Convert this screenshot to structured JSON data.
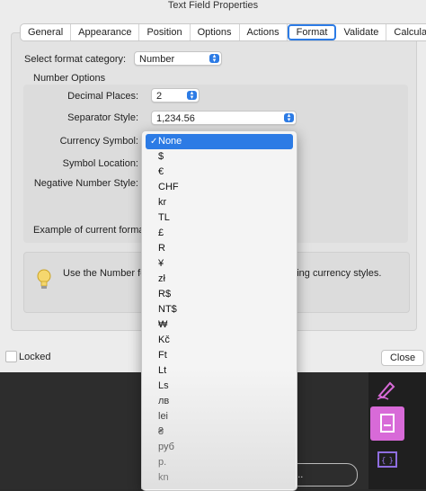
{
  "window": {
    "title": "Text Field Properties"
  },
  "tabs": [
    "General",
    "Appearance",
    "Position",
    "Options",
    "Actions",
    "Format",
    "Validate",
    "Calculate"
  ],
  "active_tab": "Format",
  "format": {
    "category_label": "Select format category:",
    "category_value": "Number",
    "section_title": "Number Options",
    "decimal_label": "Decimal Places:",
    "decimal_value": "2",
    "separator_label": "Separator Style:",
    "separator_value": "1,234.56",
    "currency_label": "Currency Symbol:",
    "symbol_location_label": "Symbol Location:",
    "negative_label": "Negative Number Style:",
    "example_label": "Example of current format:",
    "info_text_left": "Use the Number for",
    "info_text_right": "uding currency styles."
  },
  "footer": {
    "locked_label": "Locked",
    "close_label": "Close"
  },
  "currency_options": [
    "None",
    "$",
    "€",
    "CHF",
    "kr",
    "TL",
    "£",
    "R",
    "¥",
    "zł",
    "R$",
    "NT$",
    "₩",
    "Kč",
    "Ft",
    "Lt",
    "Ls",
    "лв",
    "lei",
    "₴",
    "руб",
    "p.",
    "kn"
  ],
  "selected_currency": "None",
  "background_pill": "te...",
  "colors": {
    "accent": "#2c7be5",
    "tool_highlight": "#d86ad8"
  },
  "icons": {
    "bulb": "lightbulb-icon",
    "pen": "pen-sign-icon",
    "doc": "document-icon",
    "code": "code-icon"
  }
}
